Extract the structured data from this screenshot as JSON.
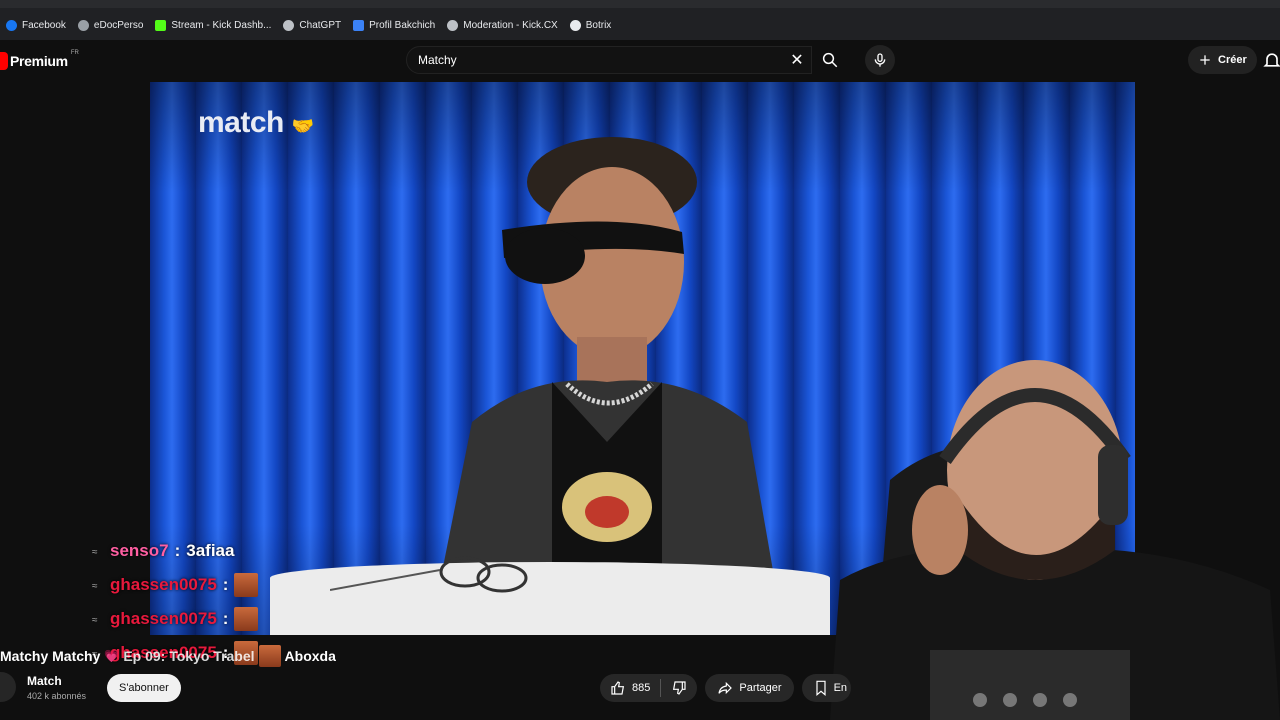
{
  "bookmarks": [
    {
      "label": "Facebook",
      "icon": "facebook-icon",
      "color": "#1877f2"
    },
    {
      "label": "eDocPerso",
      "icon": "globe-icon",
      "color": "#9aa0a6"
    },
    {
      "label": "Stream - Kick Dashb...",
      "icon": "kick-icon",
      "color": "#53fc18"
    },
    {
      "label": "ChatGPT",
      "icon": "chatgpt-icon",
      "color": "#bdc1c6"
    },
    {
      "label": "Profil Bakchich",
      "icon": "bakchich-icon",
      "color": "#3b82f6"
    },
    {
      "label": "Moderation - Kick.CX",
      "icon": "gear-icon",
      "color": "#bdc1c6"
    },
    {
      "label": "Botrix",
      "icon": "diamond-icon",
      "color": "#e8eaed"
    }
  ],
  "header": {
    "logo_text": "Premium",
    "logo_region": "FR",
    "search_value": "Matchy",
    "create_label": "Créer"
  },
  "video": {
    "watermark": "match"
  },
  "chat": [
    {
      "user": "senso7",
      "user_color": "#ff5fa2",
      "text": "3afiaa",
      "emote": false
    },
    {
      "user": "ghassen0075",
      "user_color": "#e8193c",
      "text": "",
      "emote": true
    },
    {
      "user": "ghassen0075",
      "user_color": "#e8193c",
      "text": "",
      "emote": true
    },
    {
      "user": "ghassen0075",
      "user_color": "#e8193c",
      "text": "",
      "emote": true
    }
  ],
  "title": {
    "prefix": "Matchy Matchy",
    "episode": "Ep 09: Tokyo Trabel",
    "suffix": "Aboxda"
  },
  "channel": {
    "name": "Match",
    "subscribers": "402 k abonnés",
    "subscribe_label": "S'abonner"
  },
  "actions": {
    "likes": "885",
    "share_label": "Partager",
    "save_label": "En"
  }
}
